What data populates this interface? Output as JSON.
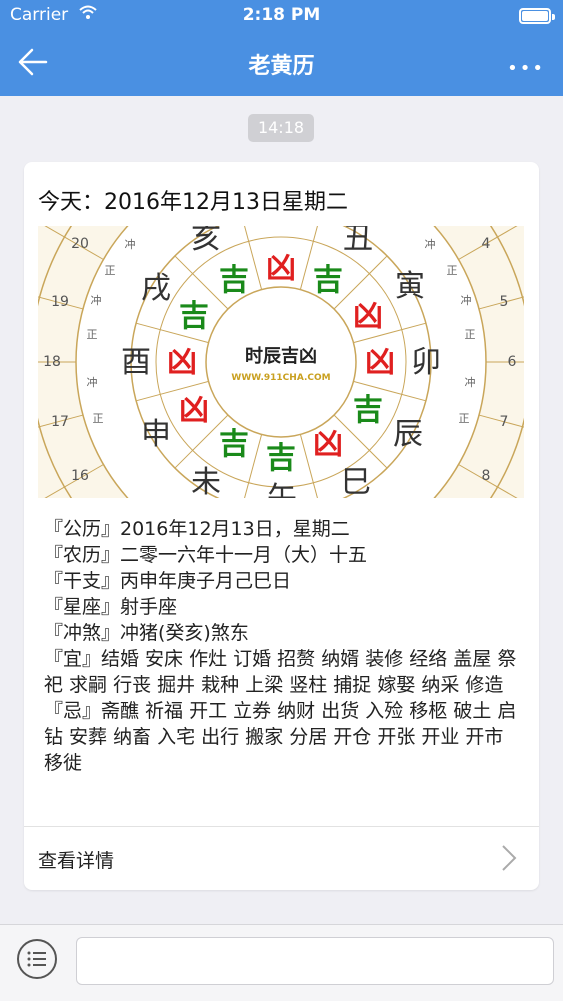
{
  "status_bar": {
    "carrier": "Carrier",
    "time": "2:18 PM"
  },
  "nav": {
    "title": "老黄历",
    "more": "•••"
  },
  "timestamp": "14:18",
  "card": {
    "title": "今天：2016年12月13日星期二",
    "wheel_image": {
      "center_title": "时辰吉凶",
      "center_url": "WWW.911CHA.COM",
      "branches": [
        "亥",
        "丑",
        "寅",
        "卯",
        "辰",
        "巳",
        "午",
        "未",
        "申",
        "酉",
        "戌"
      ],
      "fortunes": [
        "吉",
        "凶",
        "吉",
        "凶",
        "凶",
        "吉",
        "凶",
        "吉",
        "吉",
        "凶",
        "凶",
        "吉"
      ],
      "hours": [
        "20",
        "19",
        "18",
        "17",
        "16",
        "4",
        "5",
        "6",
        "7",
        "8"
      ],
      "ring_labels": [
        "冲",
        "正",
        "冲",
        "正",
        "冲",
        "正",
        "冲",
        "正",
        "冲",
        "正",
        "冲",
        "正"
      ]
    },
    "info": {
      "gongli": "『公历』2016年12月13日，星期二",
      "nongli": "『农历』二零一六年十一月（大）十五",
      "ganzhi": "『干支』丙申年庚子月己巳日",
      "xingzuo": "『星座』射手座",
      "chongsha": "『冲煞』冲猪(癸亥)煞东",
      "yi": "『宜』结婚 安床 作灶 订婚 招赘 纳婿 装修 经络 盖屋 祭祀 求嗣 行丧 掘井 栽种 上梁 竖柱 捕捉 嫁娶 纳采 修造",
      "ji": "『忌』斋醮 祈福 开工 立券 纳财 出货 入殓 移柩 破土 启钻 安葬 纳畜 入宅 出行 搬家 分居 开仓 开张 开业 开市 移徙"
    },
    "detail_label": "查看详情"
  },
  "colors": {
    "nav_bg": "#4a90e2",
    "ji_green": "#1a8a1a",
    "xiong_red": "#e02020",
    "gold": "#c9a65a"
  }
}
